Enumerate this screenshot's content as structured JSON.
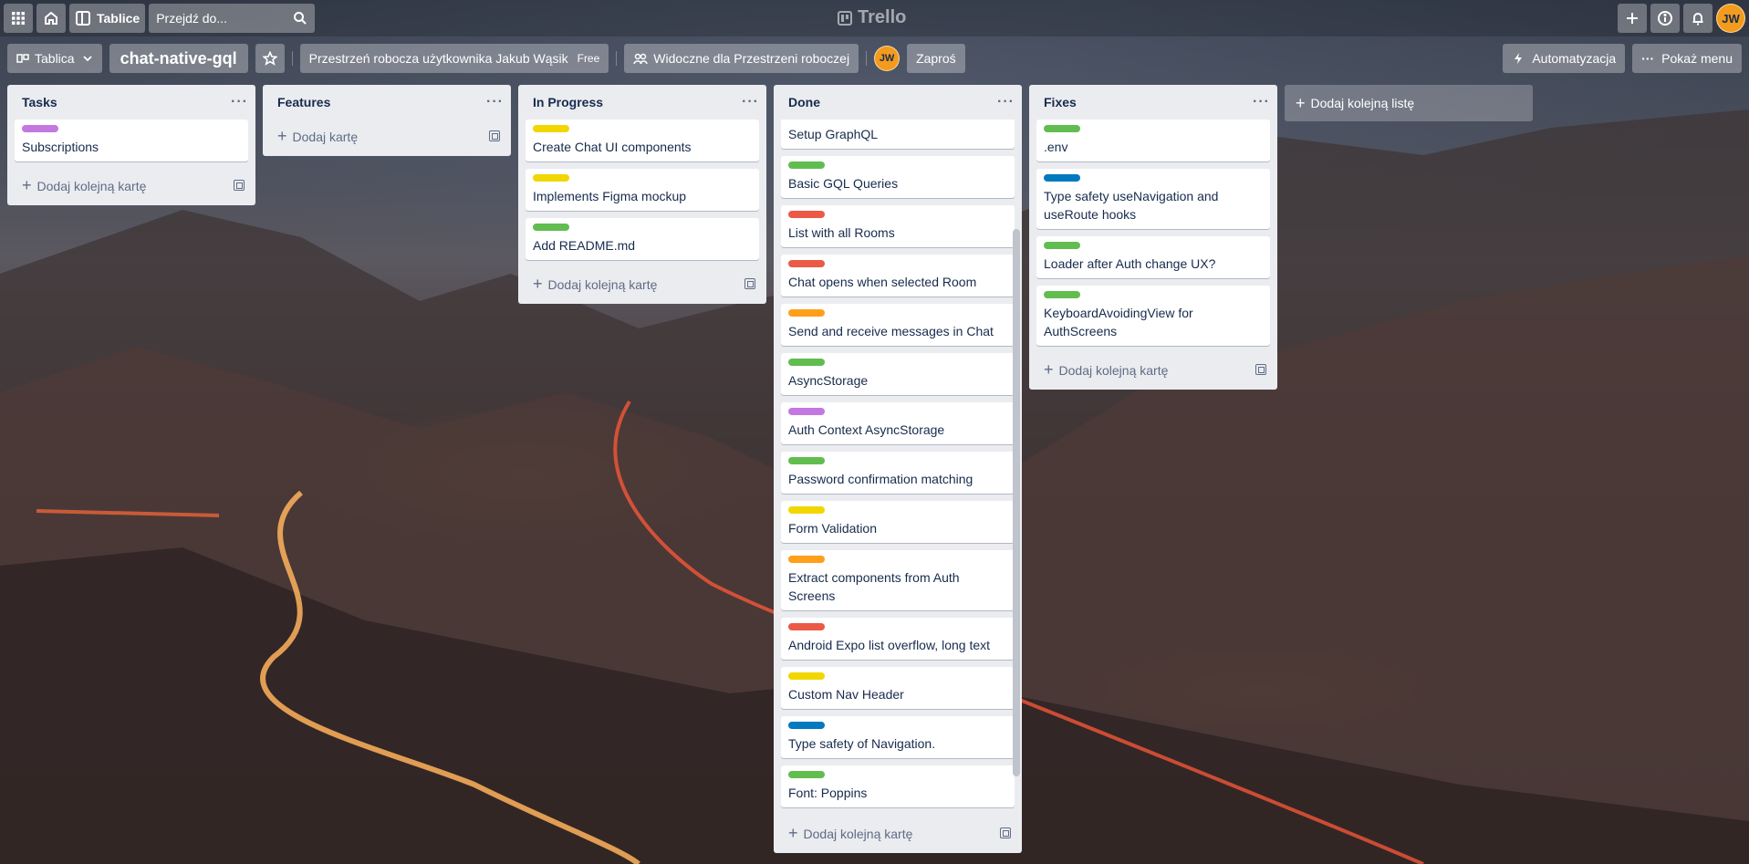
{
  "colors": {
    "green": "#61bd4f",
    "yellow": "#f2d600",
    "orange": "#ff9f1a",
    "red": "#eb5a46",
    "purple": "#c377e0",
    "blue": "#0079bf"
  },
  "topbar": {
    "apps_icon": "grid-icon",
    "home_icon": "home-icon",
    "boards_label": "Tablice",
    "search_placeholder": "Przejdź do...",
    "logo_text": "Trello",
    "right_icons": [
      "plus-icon",
      "info-icon",
      "bell-icon"
    ],
    "avatar_initials": "JW"
  },
  "boardbar": {
    "board_menu_label": "Tablica",
    "board_title": "chat-native-gql",
    "workspace_label": "Przestrzeń robocza użytkownika Jakub Wąsik",
    "free_tag": "Free",
    "visibility_label": "Widoczne dla Przestrzeni roboczej",
    "member_initials": "JW",
    "invite_label": "Zaproś",
    "automation_label": "Automatyzacja",
    "menu_label": "Pokaż menu"
  },
  "lists": [
    {
      "title": "Tasks",
      "cards": [
        {
          "label": "purple",
          "text": "Subscriptions"
        }
      ],
      "add_label": "Dodaj kolejną kartę"
    },
    {
      "title": "Features",
      "cards": [],
      "add_label": "Dodaj kartę"
    },
    {
      "title": "In Progress",
      "cards": [
        {
          "label": "yellow",
          "text": "Create Chat UI components"
        },
        {
          "label": "yellow",
          "text": "Implements Figma mockup"
        },
        {
          "label": "green",
          "text": "Add README.md"
        }
      ],
      "add_label": "Dodaj kolejną kartę"
    },
    {
      "title": "Done",
      "cards": [
        {
          "label": "red",
          "text": "Setup GraphQL"
        },
        {
          "label": "green",
          "text": "Basic GQL Queries"
        },
        {
          "label": "red",
          "text": "List with all Rooms"
        },
        {
          "label": "red",
          "text": "Chat opens when selected Room"
        },
        {
          "label": "orange",
          "text": "Send and receive messages in Chat"
        },
        {
          "label": "green",
          "text": "AsyncStorage"
        },
        {
          "label": "purple",
          "text": "Auth Context AsyncStorage"
        },
        {
          "label": "green",
          "text": "Password confirmation matching"
        },
        {
          "label": "yellow",
          "text": "Form Validation"
        },
        {
          "label": "orange",
          "text": "Extract components from Auth Screens"
        },
        {
          "label": "red",
          "text": "Android Expo list overflow, long text"
        },
        {
          "label": "yellow",
          "text": "Custom Nav Header"
        },
        {
          "label": "blue",
          "text": "Type safety of Navigation."
        },
        {
          "label": "green",
          "text": "Font: Poppins"
        }
      ],
      "add_label": "Dodaj kolejną kartę"
    },
    {
      "title": "Fixes",
      "cards": [
        {
          "label": "green",
          "text": ".env"
        },
        {
          "label": "blue",
          "text": "Type safety useNavigation and useRoute hooks"
        },
        {
          "label": "green",
          "text": "Loader after Auth change UX?"
        },
        {
          "label": "green",
          "text": "KeyboardAvoidingView for AuthScreens"
        }
      ],
      "add_label": "Dodaj kolejną kartę"
    }
  ],
  "add_list_label": "Dodaj kolejną listę"
}
